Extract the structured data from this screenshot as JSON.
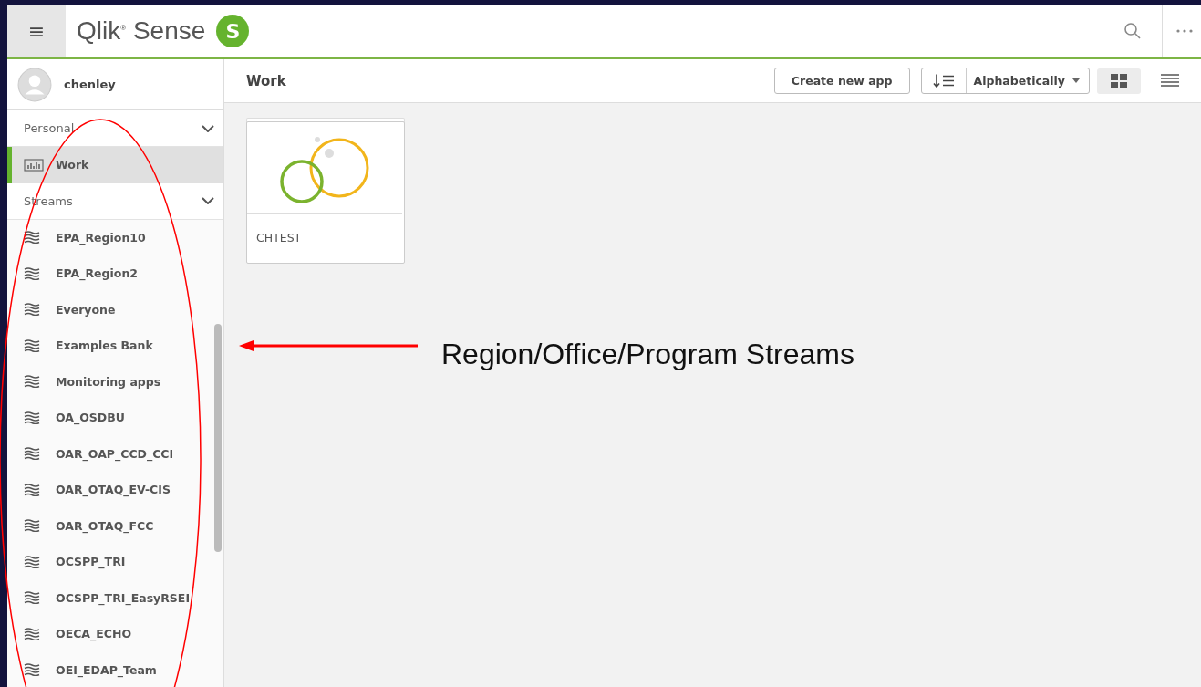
{
  "header": {
    "menu_icon": "≡",
    "brand": "Qlik$^{®}$ Sense",
    "logo_letter": "S"
  },
  "user": {
    "name": "chenley"
  },
  "sidebar": {
    "sections": [
      {
        "label": "Personal",
        "expanded": true,
        "items": [
          {
            "label": "Work",
            "kind": "work",
            "selected": true
          }
        ]
      },
      {
        "label": "Streams",
        "expanded": true,
        "items": [
          {
            "label": "EPA_Region10",
            "kind": "stream",
            "selected": false
          },
          {
            "label": "EPA_Region2",
            "kind": "stream",
            "selected": false
          },
          {
            "label": "Everyone",
            "kind": "stream",
            "selected": false
          },
          {
            "label": "Examples Bank",
            "kind": "stream",
            "selected": false
          },
          {
            "label": "Monitoring apps",
            "kind": "stream",
            "selected": false
          },
          {
            "label": "OA_OSDBU",
            "kind": "stream",
            "selected": false
          },
          {
            "label": "OAR_OAP_CCD_CCI",
            "kind": "stream",
            "selected": false
          },
          {
            "label": "OAR_OTAQ_EV-CIS",
            "kind": "stream",
            "selected": false
          },
          {
            "label": "OAR_OTAQ_FCC",
            "kind": "stream",
            "selected": false
          },
          {
            "label": "OCSPP_TRI",
            "kind": "stream",
            "selected": false
          },
          {
            "label": "OCSPP_TRI_EasyRSEI",
            "kind": "stream",
            "selected": false
          },
          {
            "label": "OECA_ECHO",
            "kind": "stream",
            "selected": false
          },
          {
            "label": "OEI_EDAP_Team",
            "kind": "stream",
            "selected": false
          }
        ]
      }
    ]
  },
  "toolbar": {
    "title": "Work",
    "create_button": "Create new app",
    "sort": "Alphabetically",
    "grid_view_selected": true,
    "list_view_selected": false
  },
  "apps": [
    {
      "name": "CHTEST"
    }
  ],
  "annotation": {
    "text": "Region/Office/Program Streams"
  }
}
